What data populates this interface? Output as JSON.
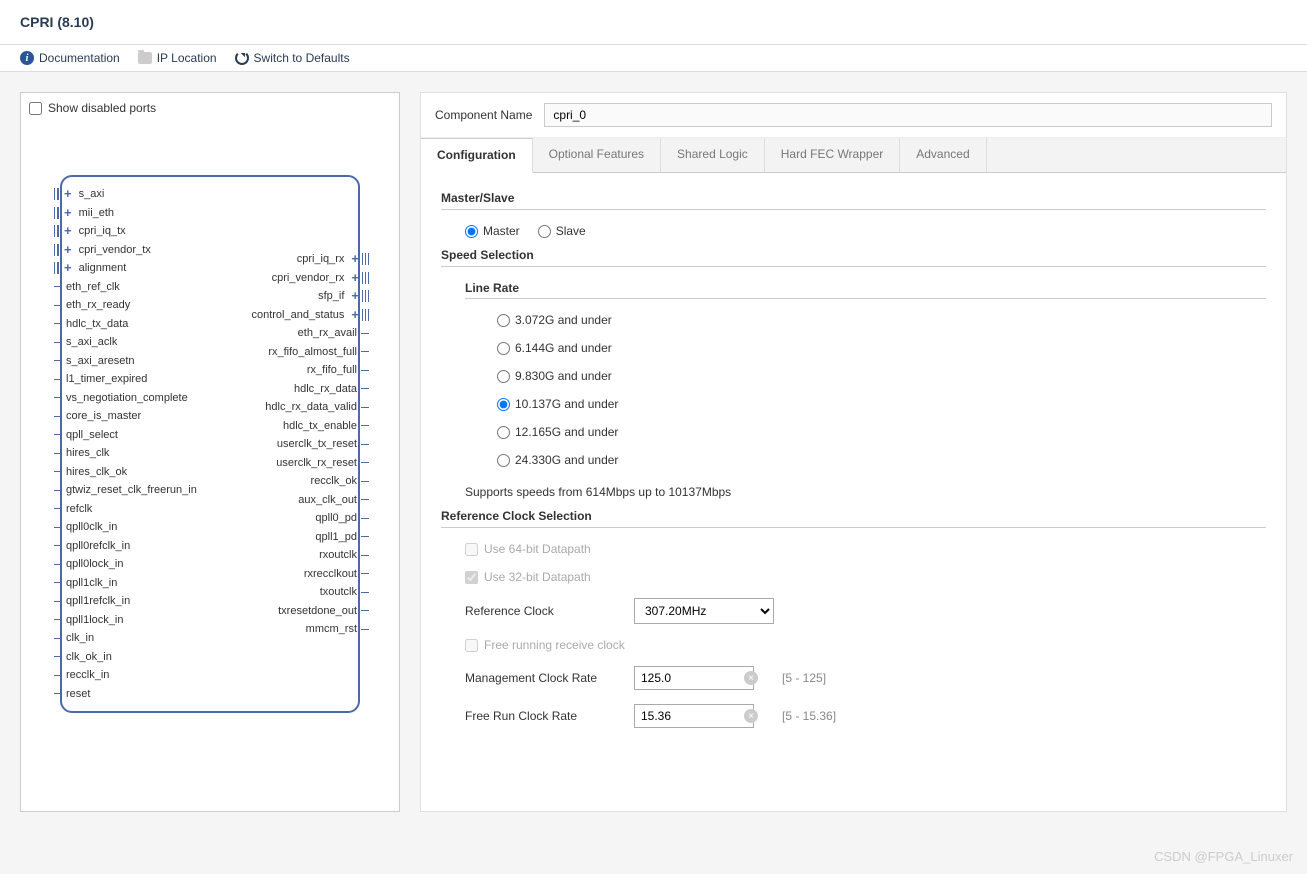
{
  "title": "CPRI (8.10)",
  "toolbar": {
    "doc": "Documentation",
    "ip_loc": "IP Location",
    "switch": "Switch to Defaults"
  },
  "left": {
    "show_disabled": "Show disabled ports",
    "ports_in_bus": [
      "s_axi",
      "mii_eth",
      "cpri_iq_tx",
      "cpri_vendor_tx",
      "alignment"
    ],
    "ports_in": [
      "eth_ref_clk",
      "eth_rx_ready",
      "hdlc_tx_data",
      "s_axi_aclk",
      "s_axi_aresetn",
      "l1_timer_expired",
      "vs_negotiation_complete",
      "core_is_master",
      "qpll_select",
      "hires_clk",
      "hires_clk_ok",
      "gtwiz_reset_clk_freerun_in",
      "refclk",
      "qpll0clk_in",
      "qpll0refclk_in",
      "qpll0lock_in",
      "qpll1clk_in",
      "qpll1refclk_in",
      "qpll1lock_in",
      "clk_in",
      "clk_ok_in",
      "recclk_in",
      "reset"
    ],
    "ports_out_bus": [
      "cpri_iq_rx",
      "cpri_vendor_rx",
      "sfp_if",
      "control_and_status"
    ],
    "ports_out": [
      "eth_rx_avail",
      "rx_fifo_almost_full",
      "rx_fifo_full",
      "hdlc_rx_data",
      "hdlc_rx_data_valid",
      "hdlc_tx_enable",
      "userclk_tx_reset",
      "userclk_rx_reset",
      "recclk_ok",
      "aux_clk_out",
      "qpll0_pd",
      "qpll1_pd",
      "rxoutclk",
      "rxrecclkout",
      "txoutclk",
      "txresetdone_out",
      "mmcm_rst"
    ]
  },
  "right": {
    "comp_name_label": "Component Name",
    "comp_name_value": "cpri_0",
    "tabs": [
      "Configuration",
      "Optional Features",
      "Shared Logic",
      "Hard FEC Wrapper",
      "Advanced"
    ],
    "master_slave_head": "Master/Slave",
    "master": "Master",
    "slave": "Slave",
    "speed_head": "Speed Selection",
    "line_rate_head": "Line Rate",
    "rates": [
      "3.072G and under",
      "6.144G and under",
      "9.830G and under",
      "10.137G and under",
      "12.165G and under",
      "24.330G and under"
    ],
    "rate_selected_index": 3,
    "support_note": "Supports speeds from 614Mbps up to 10137Mbps",
    "ref_clk_head": "Reference Clock Selection",
    "use64": "Use 64-bit Datapath",
    "use32": "Use 32-bit Datapath",
    "ref_clock_label": "Reference Clock",
    "ref_clock_value": "307.20MHz",
    "free_rx": "Free running receive clock",
    "mgmt_label": "Management Clock Rate",
    "mgmt_value": "125.0",
    "mgmt_range": "[5 - 125]",
    "free_label": "Free Run Clock Rate",
    "free_value": "15.36",
    "free_range": "[5 - 15.36]"
  },
  "watermark": "CSDN @FPGA_Linuxer"
}
